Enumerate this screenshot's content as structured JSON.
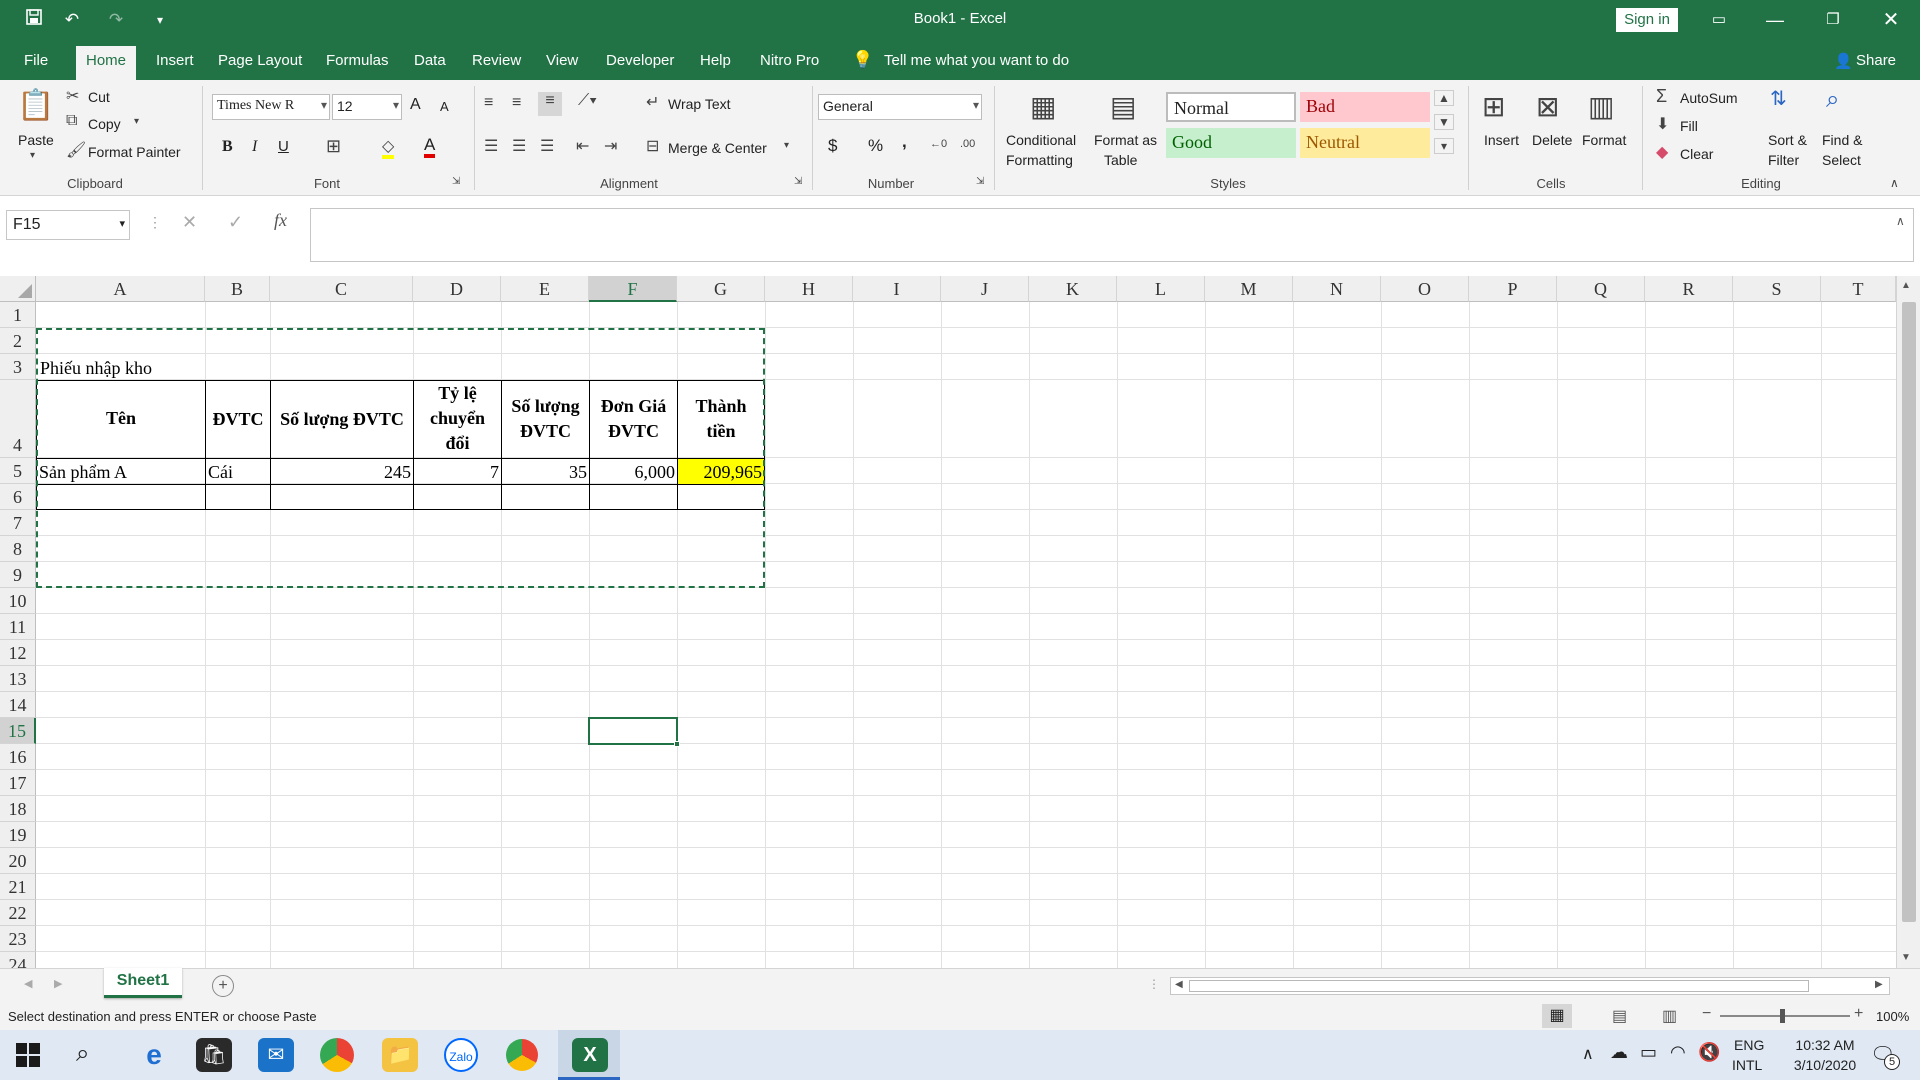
{
  "titlebar": {
    "title": "Book1  -  Excel",
    "sign_in": "Sign in",
    "qat": {
      "save": "save-icon",
      "undo": "undo-icon",
      "redo": "redo-icon",
      "customize": "customize-icon"
    }
  },
  "tabs": [
    "File",
    "Home",
    "Insert",
    "Page Layout",
    "Formulas",
    "Data",
    "Review",
    "View",
    "Developer",
    "Help",
    "Nitro Pro"
  ],
  "tell_me": "Tell me what you want to do",
  "share": "Share",
  "ribbon": {
    "clipboard": {
      "paste": "Paste",
      "cut": "Cut",
      "copy": "Copy",
      "format_painter": "Format Painter",
      "label": "Clipboard"
    },
    "font": {
      "name": "Times New R",
      "size": "12",
      "label": "Font",
      "bold": "B",
      "italic": "I",
      "underline": "U",
      "grow": "A",
      "shrink": "A",
      "font_color": "A"
    },
    "alignment": {
      "wrap_text": "Wrap Text",
      "merge_center": "Merge & Center",
      "label": "Alignment"
    },
    "number": {
      "format": "General",
      "currency": "$",
      "percent": "%",
      "comma": ",",
      "label": "Number"
    },
    "styles": {
      "conditional": "Conditional",
      "conditional2": "Formatting",
      "format_as": "Format as",
      "format_as2": "Table",
      "normal": "Normal",
      "bad": "Bad",
      "good": "Good",
      "neutral": "Neutral",
      "label": "Styles"
    },
    "cells": {
      "insert": "Insert",
      "delete": "Delete",
      "format": "Format",
      "label": "Cells"
    },
    "editing": {
      "autosum": "AutoSum",
      "fill": "Fill",
      "clear": "Clear",
      "sort": "Sort &",
      "sort2": "Filter",
      "find": "Find &",
      "find2": "Select",
      "label": "Editing"
    }
  },
  "formula_bar": {
    "name_box": "F15",
    "formula": "",
    "fx": "fx"
  },
  "columns": [
    "A",
    "B",
    "C",
    "D",
    "E",
    "F",
    "G",
    "H",
    "I",
    "J",
    "K",
    "L",
    "M",
    "N",
    "O",
    "P",
    "Q",
    "R",
    "S",
    "T"
  ],
  "rows": [
    "1",
    "2",
    "3",
    "4",
    "5",
    "6",
    "7",
    "8",
    "9",
    "10",
    "11",
    "12",
    "13",
    "14",
    "15",
    "16",
    "17",
    "18",
    "19",
    "20",
    "21",
    "22",
    "23",
    "24"
  ],
  "sheet": {
    "title": "Phiếu nhập kho",
    "headers": [
      "Tên",
      "ĐVTC",
      "Số lượng ĐVTC",
      "Tỷ lệ chuyển đổi",
      "Số lượng ĐVTC",
      "Đơn Giá ĐVTC",
      "Thành tiền"
    ],
    "row5": [
      "Sản phẩm A",
      "Cái",
      "245",
      "7",
      "35",
      "6,000",
      "209,965"
    ]
  },
  "sheet_tab": "Sheet1",
  "status": {
    "message": "Select destination and press ENTER or choose Paste",
    "zoom": "100%"
  },
  "taskbar": {
    "lang1": "ENG",
    "lang2": "INTL",
    "time": "10:32 AM",
    "date": "3/10/2020",
    "notifications": "5"
  },
  "colors": {
    "accent": "#217346",
    "highlight": "#ffff00",
    "bad_bg": "#ffc7ce",
    "good_bg": "#c6efce",
    "neutral_bg": "#ffeb9c"
  }
}
